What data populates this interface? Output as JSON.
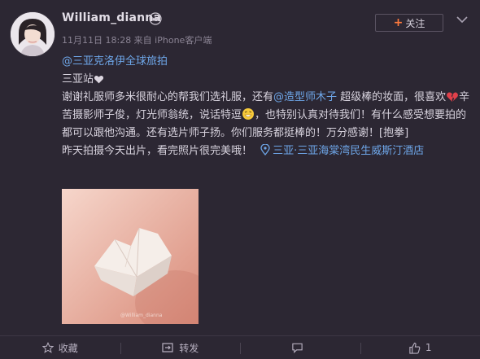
{
  "post": {
    "username": "William_dianna",
    "meta": "11月11日 18:28 来自 iPhone客户端",
    "follow_label": "关注",
    "follow_plus": "+",
    "mention": "@三亚克洛伊全球旅拍",
    "line1": "三亚站",
    "para_a": "谢谢礼服师多米很耐心的帮我们选礼服，还有",
    "mention2": "@造型师木子",
    "para_b": " 超级棒的妆面，很喜欢",
    "para_c": "辛苦摄影师子俊，灯光师翁统，说话特逗",
    "para_d": "，也特别认真对待我们！有什么感受想要拍的都可以跟他沟通。还有选片师子扬。你们服务都挺棒的！万分感谢！[抱拳]",
    "para_e": "昨天拍摄今天出片，看完照片很完美哦！",
    "location": "三亚·三亚海棠湾民生威斯汀酒店",
    "photo_watermark": "@William_dianna"
  },
  "actions": {
    "favorite_label": "收藏",
    "repost_label": "转发",
    "comment_label": "",
    "like_label": "1"
  },
  "colors": {
    "background": "#2c2733",
    "link": "#6ea6e8",
    "follow_plus": "#ff7a3d",
    "meta_text": "#8b8494"
  }
}
